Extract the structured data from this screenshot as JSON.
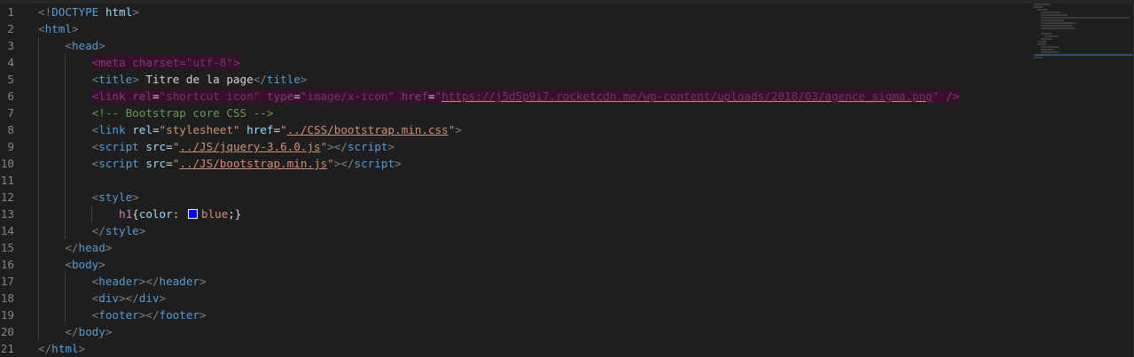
{
  "gutter": {
    "line_numbers": [
      "1",
      "2",
      "3",
      "4",
      "5",
      "6",
      "7",
      "8",
      "9",
      "10",
      "11",
      "12",
      "13",
      "14",
      "15",
      "16",
      "17",
      "18",
      "19",
      "20",
      "21"
    ]
  },
  "code": {
    "l1": {
      "open": "<!",
      "doctype": "DOCTYPE",
      "sp": " ",
      "html": "html",
      "close": ">"
    },
    "l2": {
      "open": "<",
      "tag": "html",
      "close": ">"
    },
    "l3": {
      "open": "<",
      "tag": "head",
      "close": ">"
    },
    "l4": {
      "open": "<",
      "tag": "meta",
      "sp": " ",
      "attr": "charset",
      "eq": "=",
      "val": "\"utf-8\"",
      "close": ">"
    },
    "l5": {
      "open": "<",
      "tag": "title",
      "close": ">",
      "text": " Titre de la page",
      "end_open": "</",
      "end_tag": "title",
      "end_close": ">"
    },
    "l6": {
      "open": "<",
      "tag": "link",
      "a1": "rel",
      "v1": "\"shortcut icon\"",
      "a2": "type",
      "v2": "\"image/x-icon\"",
      "a3": "href",
      "q": "\"",
      "url": "https://j5d5p9i7.rocketcdn.me/wp-content/uploads/2018/03/agence_sigma.png",
      "close": " />"
    },
    "l7": {
      "comment": "<!-- Bootstrap core CSS -->"
    },
    "l8": {
      "open": "<",
      "tag": "link",
      "a1": "rel",
      "v1": "\"stylesheet\"",
      "a2": "href",
      "q": "\"",
      "path": "../CSS/bootstrap.min.css",
      "close": ">"
    },
    "l9": {
      "open": "<",
      "tag": "script",
      "a1": "src",
      "q": "\"",
      "path": "../JS/jquery-3.6.0.js",
      "close": ">",
      "end_open": "</",
      "end_tag": "script",
      "end_close": ">"
    },
    "l10": {
      "open": "<",
      "tag": "script",
      "a1": "src",
      "q": "\"",
      "path": "../JS/bootstrap.min.js",
      "close": ">",
      "end_open": "</",
      "end_tag": "script",
      "end_close": ">"
    },
    "l12": {
      "open": "<",
      "tag": "style",
      "close": ">"
    },
    "l13": {
      "selector": "h1",
      "brace_open": "{",
      "prop": "color",
      "colon": ": ",
      "value": "blue",
      "end": ";}"
    },
    "l14": {
      "open": "</",
      "tag": "style",
      "close": ">"
    },
    "l15": {
      "open": "</",
      "tag": "head",
      "close": ">"
    },
    "l16": {
      "open": "<",
      "tag": "body",
      "close": ">"
    },
    "l17": {
      "open": "<",
      "tag": "header",
      "close": "></",
      "end_tag": "header",
      "end_close": ">"
    },
    "l18": {
      "open": "<",
      "tag": "div",
      "close": "></",
      "end_tag": "div",
      "end_close": ">"
    },
    "l19": {
      "open": "<",
      "tag": "footer",
      "close": "></",
      "end_tag": "footer",
      "end_close": ">"
    },
    "l20": {
      "open": "</",
      "tag": "body",
      "close": ">"
    },
    "l21": {
      "open": "</",
      "tag": "html",
      "close": ">"
    }
  },
  "colors": {
    "background": "#1e1e1e",
    "tag": "#569cd6",
    "attribute": "#9cdcfe",
    "string": "#ce9178",
    "comment": "#6a9955",
    "swatch": "#0000ff"
  }
}
